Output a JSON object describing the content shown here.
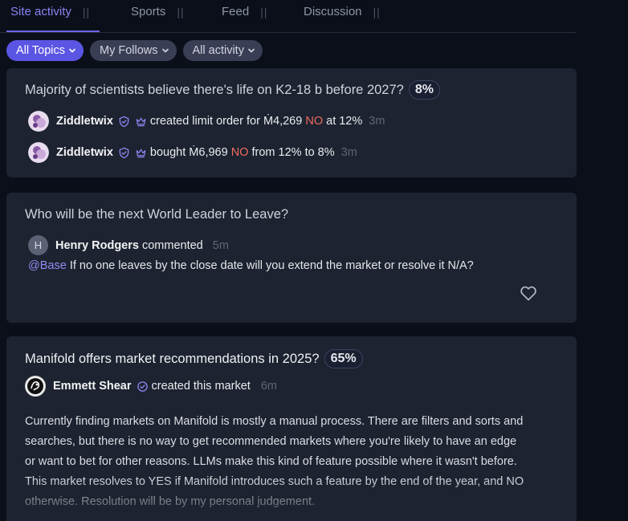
{
  "tabs": [
    {
      "label": "Site activity",
      "active": true
    },
    {
      "label": "Sports"
    },
    {
      "label": "Feed"
    },
    {
      "label": "Discussion"
    }
  ],
  "tab_separator": "||",
  "filters": {
    "topics": "All Topics",
    "follows": "My Follows",
    "activity": "All activity"
  },
  "cards": [
    {
      "title": "Majority of scientists believe there's life on K2-18 b before 2027?",
      "prob": "8%",
      "activities": [
        {
          "user": "Ziddletwix",
          "action": "created limit order for",
          "amount": "Ṁ4,269",
          "outcome": "NO",
          "detail": "at 12%",
          "time": "3m"
        },
        {
          "user": "Ziddletwix",
          "action": "bought",
          "amount": "Ṁ6,969",
          "outcome": "NO",
          "detail": "from 12% to 8%",
          "time": "3m"
        }
      ]
    },
    {
      "title": "Who will be the next World Leader to Leave?",
      "comment": {
        "avatar_letter": "H",
        "user": "Henry Rodgers",
        "action": "commented",
        "time": "5m",
        "mention": "@Base",
        "text": "If no one leaves by the close date will you extend the market or resolve it N/A?"
      }
    },
    {
      "title": "Manifold offers market recommendations in 2025?",
      "prob": "65%",
      "creator": {
        "user": "Emmett Shear",
        "action": "created this market",
        "time": "6m"
      },
      "description": [
        "Currently finding markets on Manifold is mostly a manual process. There are filters and sorts and",
        "searches, but there is no way to get recommended markets where you're likely to have an edge",
        "or want to bet for other reasons. LLMs make this kind of feature possible where it wasn't before.",
        "This market resolves to YES if Manifold introduces such a feature by the end of the year, and NO",
        "otherwise. Resolution will be by my personal judgement."
      ]
    }
  ],
  "colors": {
    "accent": "#5b55e3",
    "no": "#ef6b5f",
    "mention": "#8f8cf4",
    "card_bg": "#1d2330"
  }
}
